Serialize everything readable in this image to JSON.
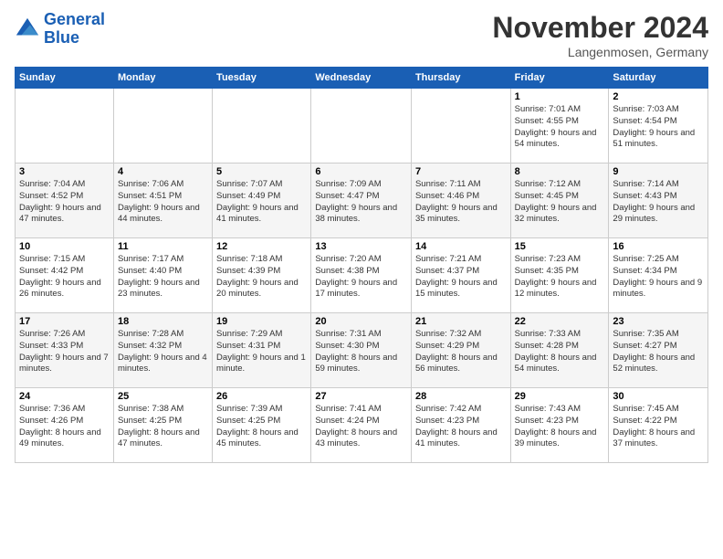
{
  "logo": {
    "line1": "General",
    "line2": "Blue"
  },
  "title": "November 2024",
  "location": "Langenmosen, Germany",
  "header_days": [
    "Sunday",
    "Monday",
    "Tuesday",
    "Wednesday",
    "Thursday",
    "Friday",
    "Saturday"
  ],
  "weeks": [
    [
      {
        "day": "",
        "info": ""
      },
      {
        "day": "",
        "info": ""
      },
      {
        "day": "",
        "info": ""
      },
      {
        "day": "",
        "info": ""
      },
      {
        "day": "",
        "info": ""
      },
      {
        "day": "1",
        "info": "Sunrise: 7:01 AM\nSunset: 4:55 PM\nDaylight: 9 hours\nand 54 minutes."
      },
      {
        "day": "2",
        "info": "Sunrise: 7:03 AM\nSunset: 4:54 PM\nDaylight: 9 hours\nand 51 minutes."
      }
    ],
    [
      {
        "day": "3",
        "info": "Sunrise: 7:04 AM\nSunset: 4:52 PM\nDaylight: 9 hours\nand 47 minutes."
      },
      {
        "day": "4",
        "info": "Sunrise: 7:06 AM\nSunset: 4:51 PM\nDaylight: 9 hours\nand 44 minutes."
      },
      {
        "day": "5",
        "info": "Sunrise: 7:07 AM\nSunset: 4:49 PM\nDaylight: 9 hours\nand 41 minutes."
      },
      {
        "day": "6",
        "info": "Sunrise: 7:09 AM\nSunset: 4:47 PM\nDaylight: 9 hours\nand 38 minutes."
      },
      {
        "day": "7",
        "info": "Sunrise: 7:11 AM\nSunset: 4:46 PM\nDaylight: 9 hours\nand 35 minutes."
      },
      {
        "day": "8",
        "info": "Sunrise: 7:12 AM\nSunset: 4:45 PM\nDaylight: 9 hours\nand 32 minutes."
      },
      {
        "day": "9",
        "info": "Sunrise: 7:14 AM\nSunset: 4:43 PM\nDaylight: 9 hours\nand 29 minutes."
      }
    ],
    [
      {
        "day": "10",
        "info": "Sunrise: 7:15 AM\nSunset: 4:42 PM\nDaylight: 9 hours\nand 26 minutes."
      },
      {
        "day": "11",
        "info": "Sunrise: 7:17 AM\nSunset: 4:40 PM\nDaylight: 9 hours\nand 23 minutes."
      },
      {
        "day": "12",
        "info": "Sunrise: 7:18 AM\nSunset: 4:39 PM\nDaylight: 9 hours\nand 20 minutes."
      },
      {
        "day": "13",
        "info": "Sunrise: 7:20 AM\nSunset: 4:38 PM\nDaylight: 9 hours\nand 17 minutes."
      },
      {
        "day": "14",
        "info": "Sunrise: 7:21 AM\nSunset: 4:37 PM\nDaylight: 9 hours\nand 15 minutes."
      },
      {
        "day": "15",
        "info": "Sunrise: 7:23 AM\nSunset: 4:35 PM\nDaylight: 9 hours\nand 12 minutes."
      },
      {
        "day": "16",
        "info": "Sunrise: 7:25 AM\nSunset: 4:34 PM\nDaylight: 9 hours\nand 9 minutes."
      }
    ],
    [
      {
        "day": "17",
        "info": "Sunrise: 7:26 AM\nSunset: 4:33 PM\nDaylight: 9 hours\nand 7 minutes."
      },
      {
        "day": "18",
        "info": "Sunrise: 7:28 AM\nSunset: 4:32 PM\nDaylight: 9 hours\nand 4 minutes."
      },
      {
        "day": "19",
        "info": "Sunrise: 7:29 AM\nSunset: 4:31 PM\nDaylight: 9 hours\nand 1 minute."
      },
      {
        "day": "20",
        "info": "Sunrise: 7:31 AM\nSunset: 4:30 PM\nDaylight: 8 hours\nand 59 minutes."
      },
      {
        "day": "21",
        "info": "Sunrise: 7:32 AM\nSunset: 4:29 PM\nDaylight: 8 hours\nand 56 minutes."
      },
      {
        "day": "22",
        "info": "Sunrise: 7:33 AM\nSunset: 4:28 PM\nDaylight: 8 hours\nand 54 minutes."
      },
      {
        "day": "23",
        "info": "Sunrise: 7:35 AM\nSunset: 4:27 PM\nDaylight: 8 hours\nand 52 minutes."
      }
    ],
    [
      {
        "day": "24",
        "info": "Sunrise: 7:36 AM\nSunset: 4:26 PM\nDaylight: 8 hours\nand 49 minutes."
      },
      {
        "day": "25",
        "info": "Sunrise: 7:38 AM\nSunset: 4:25 PM\nDaylight: 8 hours\nand 47 minutes."
      },
      {
        "day": "26",
        "info": "Sunrise: 7:39 AM\nSunset: 4:25 PM\nDaylight: 8 hours\nand 45 minutes."
      },
      {
        "day": "27",
        "info": "Sunrise: 7:41 AM\nSunset: 4:24 PM\nDaylight: 8 hours\nand 43 minutes."
      },
      {
        "day": "28",
        "info": "Sunrise: 7:42 AM\nSunset: 4:23 PM\nDaylight: 8 hours\nand 41 minutes."
      },
      {
        "day": "29",
        "info": "Sunrise: 7:43 AM\nSunset: 4:23 PM\nDaylight: 8 hours\nand 39 minutes."
      },
      {
        "day": "30",
        "info": "Sunrise: 7:45 AM\nSunset: 4:22 PM\nDaylight: 8 hours\nand 37 minutes."
      }
    ]
  ]
}
